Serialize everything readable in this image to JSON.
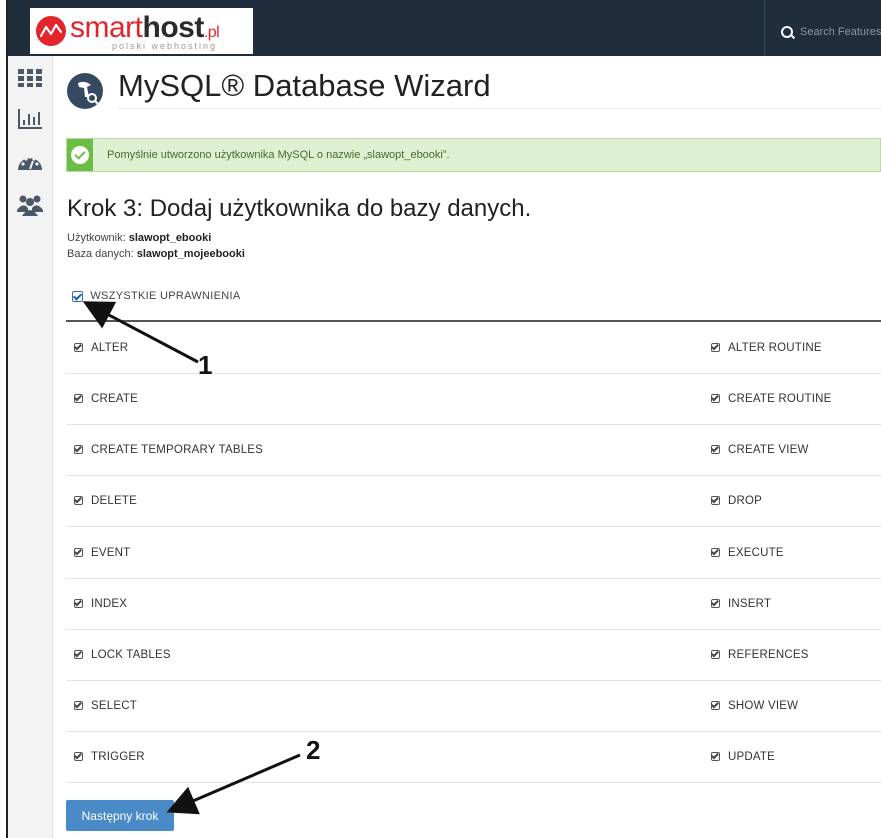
{
  "header": {
    "logo": {
      "smart": "smart",
      "host": "host",
      "tld": ".pl",
      "tagline": "polski webhosting"
    },
    "search_placeholder": "Search Features"
  },
  "sidebar": {
    "icons": [
      "grid-icon",
      "bar-chart-icon",
      "dashboard-gauge-icon",
      "users-icon"
    ]
  },
  "main": {
    "title": "MySQL® Database Wizard",
    "alert": "Pomyślnie utworzono użytkownika MySQL o nazwie „slawopt_ebooki”.",
    "step_title": "Krok 3: Dodaj użytkownika do bazy danych.",
    "user_label": "Użytkownik:",
    "user_value": "slawopt_ebooki",
    "db_label": "Baza danych:",
    "db_value": "slawopt_mojeebooki",
    "all_privileges": "WSZYSTKIE UPRAWNIENIA",
    "privileges_left": [
      "ALTER",
      "CREATE",
      "CREATE TEMPORARY TABLES",
      "DELETE",
      "EVENT",
      "INDEX",
      "LOCK TABLES",
      "SELECT",
      "TRIGGER"
    ],
    "privileges_right": [
      "ALTER ROUTINE",
      "CREATE ROUTINE",
      "CREATE VIEW",
      "DROP",
      "EXECUTE",
      "INSERT",
      "REFERENCES",
      "SHOW VIEW",
      "UPDATE"
    ],
    "next_button": "Następny krok"
  },
  "annotations": {
    "one": "1",
    "two": "2"
  },
  "colors": {
    "topbar": "#1f2d3d",
    "brand_red": "#e0262c",
    "button": "#4a8bc7",
    "alert_bg": "#ddf0d2",
    "alert_badge": "#6bbd45"
  }
}
